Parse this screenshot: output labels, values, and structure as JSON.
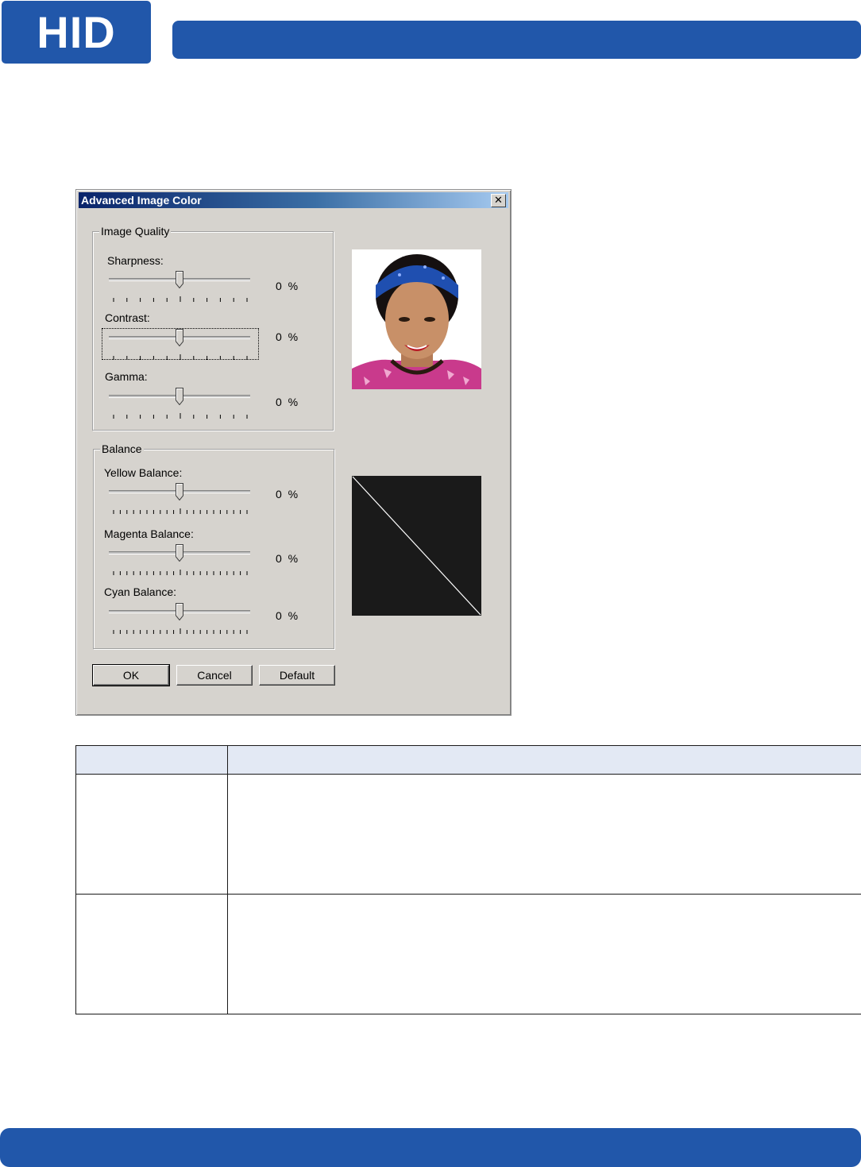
{
  "brand": {
    "logo_text": "HID",
    "color": "#2157aa"
  },
  "dialog": {
    "title": "Advanced Image Color",
    "close_symbol": "✕",
    "image_quality": {
      "title": "Image Quality",
      "sliders": [
        {
          "label": "Sharpness:",
          "value": "0",
          "unit": "%",
          "level": 0.5
        },
        {
          "label": "Contrast:",
          "value": "0",
          "unit": "%",
          "level": 0.5
        },
        {
          "label": "Gamma:",
          "value": "0",
          "unit": "%",
          "level": 0.5
        }
      ]
    },
    "balance": {
      "title": "Balance",
      "sliders": [
        {
          "label": "Yellow Balance:",
          "value": "0",
          "unit": "%",
          "level": 0.5
        },
        {
          "label": "Magenta Balance:",
          "value": "0",
          "unit": "%",
          "level": 0.5
        },
        {
          "label": "Cyan Balance:",
          "value": "0",
          "unit": "%",
          "level": 0.5
        }
      ]
    },
    "buttons": {
      "ok": "OK",
      "cancel": "Cancel",
      "default": "Default"
    }
  },
  "table": {
    "headers": [
      "",
      ""
    ],
    "rows": [
      [
        "",
        ""
      ],
      [
        "",
        ""
      ]
    ]
  }
}
